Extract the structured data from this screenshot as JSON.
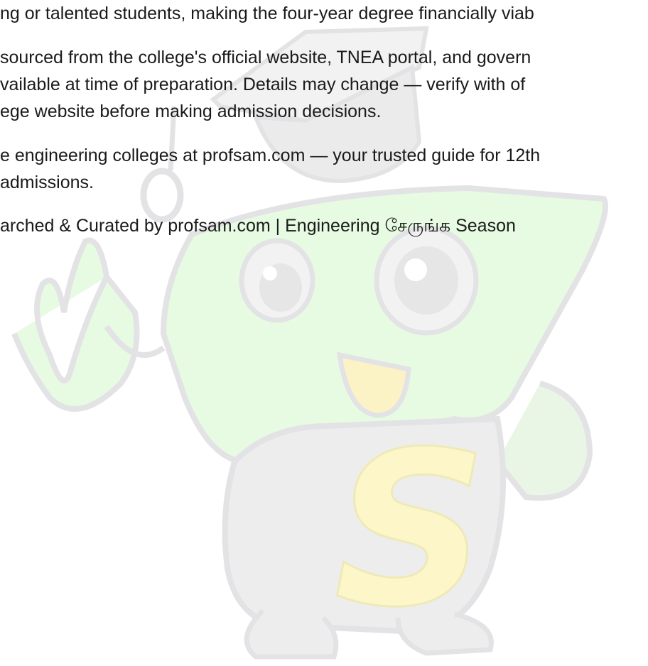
{
  "document": {
    "lines": [
      "ng or talented students, making the four-year degree financially viab",
      "sourced from the college's official website, TNEA portal, and govern",
      "vailable at time of preparation. Details may change — verify with of",
      "ege website before making admission decisions.",
      "e engineering colleges at profsam.com — your trusted guide for 12th",
      "admissions.",
      "arched & Curated by profsam.com | Engineering சேருங்க Season"
    ]
  },
  "watermark": {
    "letter": "S",
    "colors": {
      "body_green": "#e6fbe2",
      "body_gray": "#ededee",
      "outline": "#e3e3e6",
      "letter_yellow": "#fdf6c8",
      "mouth_yellow": "#fbf2c6",
      "cap": "#eeeeef"
    }
  }
}
